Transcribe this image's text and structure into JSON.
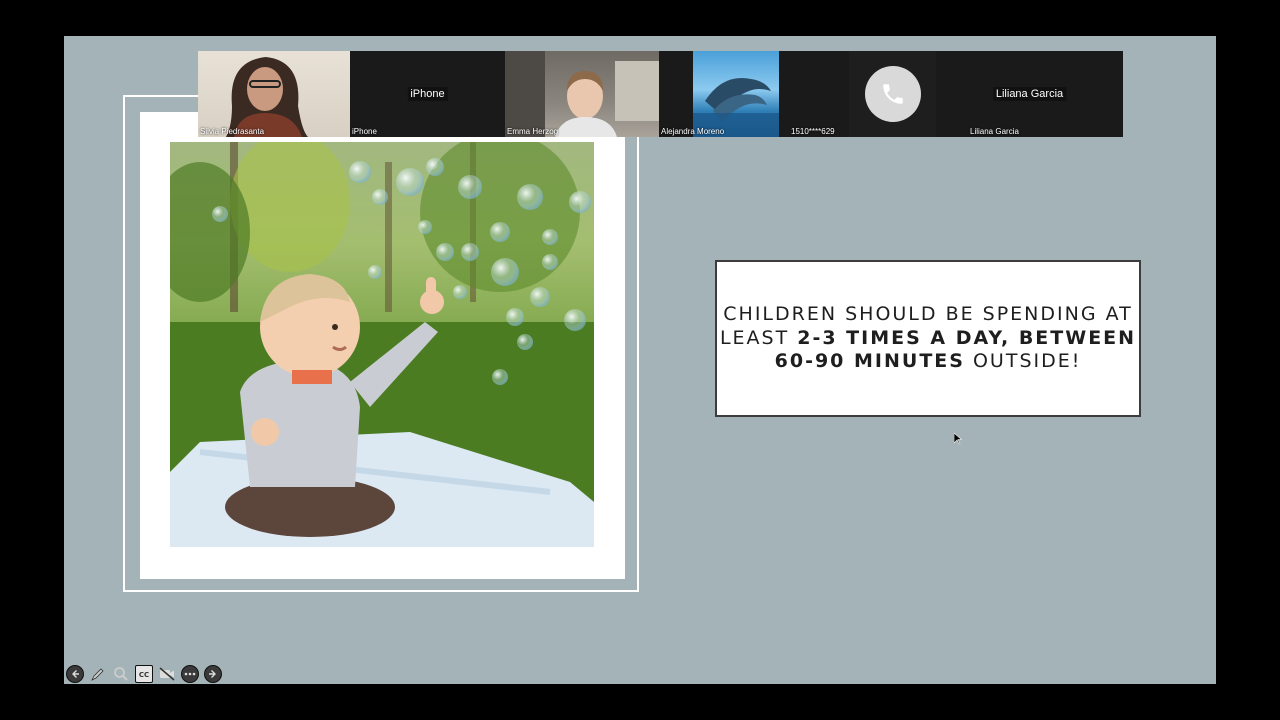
{
  "participants": [
    {
      "name": "Silvia Piedrasanta",
      "label": ""
    },
    {
      "name": "iPhone",
      "label": "iPhone"
    },
    {
      "name": "Emma Herzog",
      "label": ""
    },
    {
      "name": "Alejandra Moreno",
      "label": ""
    },
    {
      "name": "1510****629",
      "label": ""
    },
    {
      "name": "Liliana Garcia",
      "label": "Liliana Garcia"
    }
  ],
  "slide": {
    "text_normal_1": "Children should be spending at least ",
    "text_bold_1": "2-3 times a day, between 60-90 minutes",
    "text_normal_2": " outside!"
  },
  "toolbar": {
    "icons": [
      "arrow-left-icon",
      "pen-icon",
      "zoom-icon",
      "closed-caption-icon",
      "video-off-icon",
      "more-icon",
      "arrow-right-icon"
    ]
  }
}
